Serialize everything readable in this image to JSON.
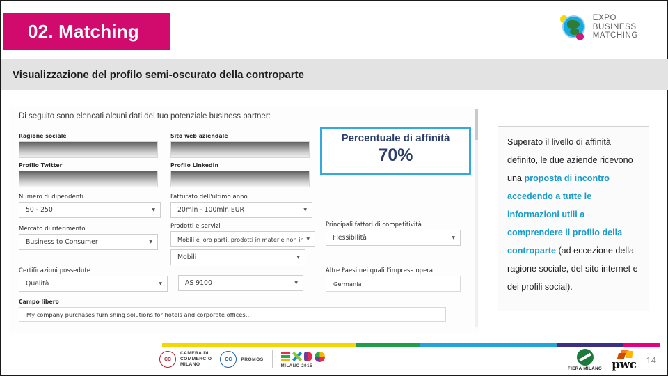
{
  "header": {
    "section_title": "02. Matching",
    "banner_color": "#d10a6e",
    "logo": {
      "line1": "EXPO",
      "line2": "BUSINESS",
      "line3": "MATCHING"
    }
  },
  "subtitle": "Visualizzazione del profilo semi-oscurato della controparte",
  "app_screenshot": {
    "intro": "Di seguito sono elencati alcuni dati del tuo potenziale business partner:",
    "fields": [
      {
        "label": "Ragione sociale",
        "type": "masked"
      },
      {
        "label": "Sito web aziendale",
        "type": "masked"
      },
      {
        "label": "Profilo Twitter",
        "type": "masked"
      },
      {
        "label": "Profilo LinkedIn",
        "type": "masked"
      },
      {
        "label": "Numero di dipendenti",
        "type": "select",
        "value": "50 - 250"
      },
      {
        "label": "Fatturato dell'ultimo anno",
        "type": "select",
        "value": "20mln - 100mln EUR"
      },
      {
        "label": "Mercato di riferimento",
        "type": "select",
        "value": "Business to Consumer"
      },
      {
        "label": "Prodotti e servizi",
        "type": "select",
        "value": "Mobili e loro parti, prodotti  in materie non in"
      },
      {
        "label": "",
        "type": "select",
        "value": "Mobili"
      },
      {
        "label": "Principali fattori di competitività",
        "type": "select",
        "value": "Flessibilità"
      },
      {
        "label": "Certificazioni possedute",
        "type": "select",
        "value": "Qualità"
      },
      {
        "label": "",
        "type": "select",
        "value": "AS 9100"
      },
      {
        "label": "Altre Paesi nei quali l'impresa opera",
        "type": "text",
        "value": "Germania"
      },
      {
        "label": "Campo libero",
        "type": "text",
        "value": "My company purchases furnishing solutions for hotels and corporate offices…"
      }
    ]
  },
  "affinity_box": {
    "caption": "Percentuale di affinità",
    "value": "70%",
    "border_color": "#32aadd",
    "text_color": "#2b3e6b"
  },
  "callout": {
    "accent_color": "#1b9bc9",
    "segments": [
      {
        "text": "Superato il livello di affinità definito, le due aziende ricevono una ",
        "highlight": false
      },
      {
        "text": "proposta di incontro accedendo a tutte le informazioni utili a comprendere il profilo della controparte",
        "highlight": true
      },
      {
        "text": " (ad eccezione della ragione sociale, del sito internet e dei profili social).",
        "highlight": false
      }
    ]
  },
  "footer": {
    "stripe_colors": [
      "#f5d600",
      "#1e9e4a",
      "#22a5dd",
      "#3b3184",
      "#e6007e"
    ],
    "partners": [
      {
        "name": "CAMERA DI COMMERCIO MILANO"
      },
      {
        "name": "PROMOS"
      },
      {
        "name": "EXPO MILANO 2015"
      },
      {
        "name": "FIERA MILANO"
      },
      {
        "name": "pwc"
      }
    ],
    "camera_lines": [
      "CAMERA DI",
      "COMMERCIO",
      "MILANO"
    ],
    "promos_label": "PROMOS",
    "expo_sub": "MILANO 2015",
    "fiera_label": "FIERA MILANO",
    "pwc_label": "pwc",
    "page_number": "14"
  }
}
